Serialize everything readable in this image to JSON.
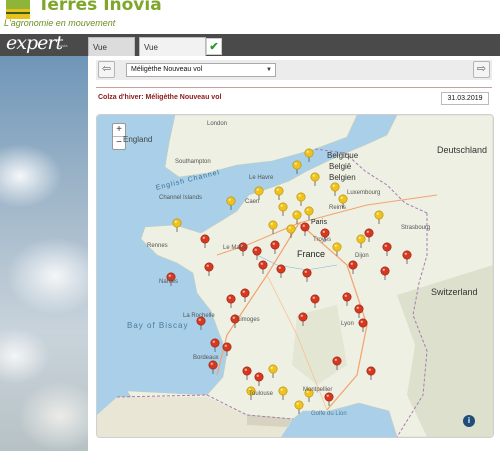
{
  "brand": {
    "name": "Terres Inovia",
    "tagline": "L'agronomie en mouvement"
  },
  "app": {
    "name": "expert",
    "sub": "inovia"
  },
  "tabs": [
    {
      "label": "Vue détaillée"
    },
    {
      "label": "Vue cartographique"
    }
  ],
  "toolbar": {
    "selected_option": "Méligèthe Nouveau vol"
  },
  "map": {
    "title": "Colza d'hiver: Méligèthe Nouveau vol",
    "date": "31.03.2019",
    "zoom_in": "+",
    "zoom_out": "−",
    "info": "i",
    "labels": {
      "england": "England",
      "english_channel": "English Channel",
      "channel_islands": "Channel Islands",
      "southampton": "Southampton",
      "london": "London",
      "belgique": "Belgique",
      "belgie": "België",
      "belgien": "Belgien",
      "luxembourg": "Luxembourg",
      "deutschland": "Deutschland",
      "france": "France",
      "switzerland": "Switzerland",
      "bay_of_biscay": "Bay of Biscay",
      "paris": "Paris",
      "rennes": "Rennes",
      "nantes": "Nantes",
      "bordeaux": "Bordeaux",
      "toulouse": "Toulouse",
      "lyon": "Lyon",
      "limoges": "Limoges",
      "caen": "Caen",
      "strasbourg": "Strasbourg",
      "dijon": "Dijon",
      "le_mans": "Le Mans",
      "golfe_du_lion": "Golfe du Lion",
      "montpellier": "Montpellier",
      "le_havre": "Le Havre",
      "reims": "Reims",
      "troyes": "Troyes",
      "la_rochelle": "La Rochelle"
    },
    "colors": {
      "red_marker": "#d9381e",
      "yellow_marker": "#f2c218",
      "land": "#eef0e3",
      "sea": "#a9d0e8"
    }
  }
}
